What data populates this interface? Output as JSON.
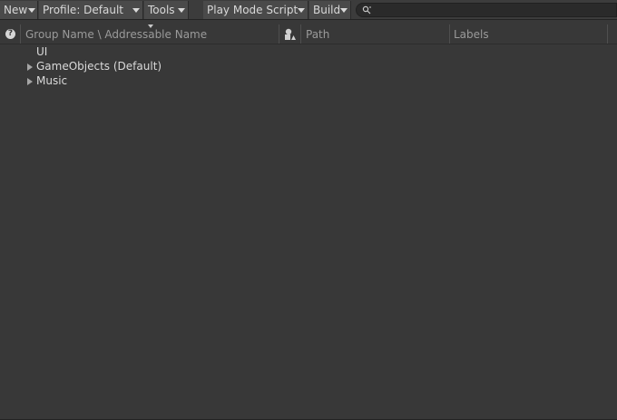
{
  "toolbar": {
    "new_label": "New",
    "profile_label": "Profile: Default",
    "tools_label": "Tools",
    "play_mode_label": "Play Mode Script",
    "build_label": "Build",
    "search_placeholder": ""
  },
  "columns": {
    "group_name": "Group Name \\ Addressable Name",
    "path": "Path",
    "labels": "Labels"
  },
  "tree": {
    "items": [
      {
        "label": "UI",
        "expandable": false
      },
      {
        "label": "GameObjects (Default)",
        "expandable": true
      },
      {
        "label": "Music",
        "expandable": true
      }
    ]
  },
  "icons": {
    "help": "help-icon",
    "search": "search-icon",
    "type": "asset-type-icon",
    "dropdown": "chevron-down-icon",
    "foldout": "chevron-right-icon"
  },
  "colors": {
    "background": "#383838",
    "toolbar": "#3c3c3c",
    "button": "#4a4a4a",
    "text": "#dadada",
    "header_text": "#9a9a9a"
  }
}
